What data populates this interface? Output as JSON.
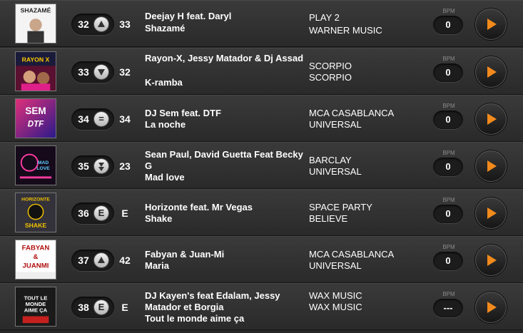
{
  "rows": [
    {
      "rank": "32",
      "trend": "up",
      "prev": "33",
      "artist": "Deejay H feat. Daryl",
      "title": "Shazamé",
      "label": "PLAY 2",
      "distrib": "WARNER MUSIC",
      "bpm_label": "BPM",
      "bpm": "0",
      "cover_text": "SHAZAMÉ"
    },
    {
      "rank": "33",
      "trend": "down",
      "prev": "32",
      "artist": "Rayon-X, Jessy Matador & Dj Assad",
      "title": "K-ramba",
      "label": "SCORPIO",
      "distrib": "SCORPIO",
      "bpm_label": "BPM",
      "bpm": "0",
      "cover_text": "RAYON X"
    },
    {
      "rank": "34",
      "trend": "same",
      "trend_label": "=",
      "prev": "34",
      "artist": "DJ Sem feat. DTF",
      "title": "La noche",
      "label": "MCA CASABLANCA",
      "distrib": "UNIVERSAL",
      "bpm_label": "BPM",
      "bpm": "0",
      "cover_text": "SEM"
    },
    {
      "rank": "35",
      "trend": "down-strong",
      "prev": "23",
      "artist": "Sean Paul, David Guetta Feat Becky G",
      "title": "Mad love",
      "label": "BARCLAY",
      "distrib": "UNIVERSAL",
      "bpm_label": "BPM",
      "bpm": "0",
      "cover_text": "MAD LOVE"
    },
    {
      "rank": "36",
      "trend": "entry",
      "trend_label": "E",
      "prev": "E",
      "artist": "Horizonte feat. Mr Vegas",
      "title": "Shake",
      "label": "SPACE PARTY",
      "distrib": "BELIEVE",
      "bpm_label": "BPM",
      "bpm": "0",
      "cover_text": "SHAKE"
    },
    {
      "rank": "37",
      "trend": "up",
      "prev": "42",
      "artist": "Fabyan & Juan-Mi",
      "title": "Maria",
      "label": "MCA CASABLANCA",
      "distrib": "UNIVERSAL",
      "bpm_label": "BPM",
      "bpm": "0",
      "cover_text": "FABYAN"
    },
    {
      "rank": "38",
      "trend": "entry",
      "trend_label": "E",
      "prev": "E",
      "artist": "DJ Kayen's feat Edalam, Jessy Matador et Borgia",
      "title": "Tout le monde aime ça",
      "label": "WAX MUSIC",
      "distrib": "WAX MUSIC",
      "bpm_label": "BPM",
      "bpm": "---",
      "cover_text": "TOUT LE MONDE"
    }
  ],
  "colors": {
    "accent": "#f28a1c",
    "text": "#ffffff",
    "muted": "#8a8a8a",
    "row_bg": "#333333"
  },
  "icons": {
    "play": "play-icon",
    "trend_up": "arrow-up-icon",
    "trend_down": "arrow-down-icon",
    "trend_down_strong": "double-arrow-down-icon"
  }
}
